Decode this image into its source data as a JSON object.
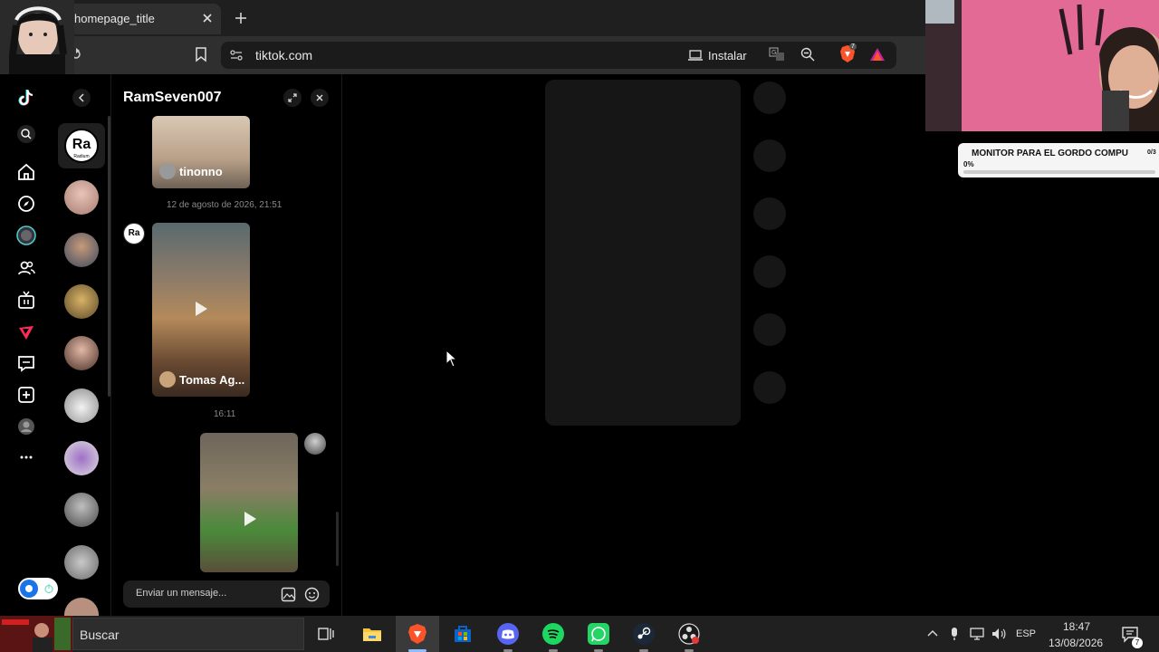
{
  "browser": {
    "tab_title": "homepage_title",
    "url": "tiktok.com",
    "install_label": "Instalar",
    "shield_count": "7"
  },
  "chat": {
    "title": "RamSeven007",
    "messages": [
      {
        "author": "tinonno"
      },
      {
        "timestamp": "12 de agosto de 2026, 21:51",
        "author": "Tomas Ag..."
      },
      {
        "timestamp": "16:11"
      }
    ],
    "input_placeholder": "Enviar un mensaje...",
    "conv_active_badge": {
      "line1": "Ra",
      "line2": "Radium"
    }
  },
  "stream_overlay": {
    "goal_title": "MONITOR PARA EL GORDO COMPU",
    "goal_count": "0/3",
    "goal_percent": "0%",
    "goal_fraction": 0.0
  },
  "taskbar": {
    "search_label": "Buscar",
    "language": "ESP",
    "time": "18:47",
    "date": "13/08/2026",
    "notifications": "7"
  },
  "colors": {
    "tiktok_red": "#fe2c55",
    "brave_orange": "#fb542b"
  }
}
